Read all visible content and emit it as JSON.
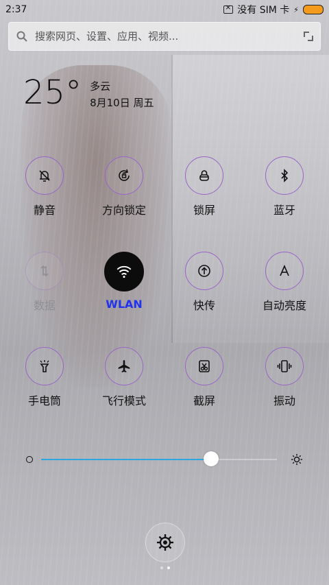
{
  "status": {
    "time": "2:37",
    "sim_text": "没有 SIM 卡",
    "battery_color": "#f49b1d"
  },
  "search": {
    "placeholder": "搜索网页、设置、应用、视频..."
  },
  "weather": {
    "temperature": "25°",
    "condition": "多云",
    "date": "8月10日 周五"
  },
  "toggles": [
    {
      "label": "静音",
      "icon": "bell-off-icon",
      "active": false
    },
    {
      "label": "方向锁定",
      "icon": "rotation-lock-icon",
      "active": false
    },
    {
      "label": "锁屏",
      "icon": "lock-icon",
      "active": false
    },
    {
      "label": "蓝牙",
      "icon": "bluetooth-icon",
      "active": false
    },
    {
      "label": "数据",
      "icon": "data-arrows-icon",
      "active": false
    },
    {
      "label": "WLAN",
      "icon": "wifi-icon",
      "active": true
    },
    {
      "label": "快传",
      "icon": "transfer-icon",
      "active": false
    },
    {
      "label": "自动亮度",
      "icon": "auto-brightness-icon",
      "active": false
    },
    {
      "label": "手电筒",
      "icon": "flashlight-icon",
      "active": false
    },
    {
      "label": "飞行模式",
      "icon": "airplane-icon",
      "active": false
    },
    {
      "label": "截屏",
      "icon": "screenshot-icon",
      "active": false
    },
    {
      "label": "振动",
      "icon": "vibrate-icon",
      "active": false
    }
  ],
  "brightness": {
    "level": 0.72,
    "accent_color": "#2aa7e0"
  },
  "pager": {
    "count": 2,
    "current": 2
  }
}
